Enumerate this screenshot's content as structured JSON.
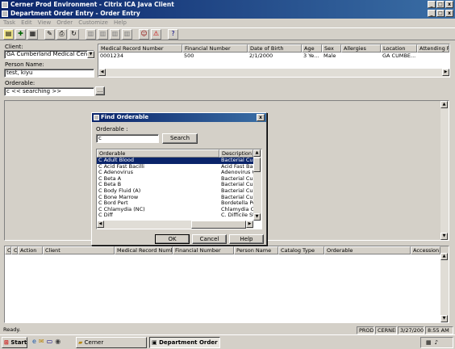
{
  "outer_window": {
    "title": "Cerner Prod Environment - Citrix ICA Java Client"
  },
  "app_window": {
    "title": "Department Order Entry - Order Entry"
  },
  "window_buttons": {
    "minimize": "_",
    "maximize": "□",
    "close": "x"
  },
  "menu": [
    "Task",
    "Edit",
    "View",
    "Order",
    "Customize",
    "Help"
  ],
  "toolbar_icons": [
    "open-icon",
    "new-order-icon",
    "multi-order-icon",
    "sign-icon",
    "print-icon",
    "refresh-icon",
    "grid1-icon",
    "grid2-icon",
    "grid3-icon",
    "grid4-icon",
    "person-icon",
    "alert-icon",
    "help-icon"
  ],
  "client": {
    "label": "Client:",
    "value": "GA Cumberland Medical Center"
  },
  "person": {
    "label": "Person Name:",
    "value": "test, kiyu"
  },
  "orderable": {
    "label": "Orderable:",
    "value": "c  << searching >>",
    "browse": "..."
  },
  "person_grid": {
    "columns": [
      "Medical Record Number",
      "Financial Number",
      "Date of Birth",
      "Age",
      "Sex",
      "Allergies",
      "Location",
      "Attending Phy"
    ],
    "row": [
      "0001234",
      "500",
      "2/1/2000",
      "3 Ye...",
      "Male",
      "",
      "GA CUMBE...",
      ""
    ]
  },
  "order_grid": {
    "columns": [
      "C",
      "C",
      "Action",
      "Client",
      "Medical Record Number",
      "Financial Number",
      "Person Name",
      "Catalog Type",
      "Orderable",
      "Accession"
    ]
  },
  "dialog": {
    "title": "Find Orderable",
    "close": "x",
    "orderable_label": "Orderable :",
    "search_value": "c",
    "search_button": "Search",
    "columns": [
      "Orderable",
      "Description"
    ],
    "rows": [
      [
        "C Adult Blood",
        "Bacterial Cultu"
      ],
      [
        "C Acid Fast Bacilli",
        "Acid Fast Bacil"
      ],
      [
        "C Adenovirus",
        "Adenovirus Cul"
      ],
      [
        "C Beta A",
        "Bacterial Cultu"
      ],
      [
        "C Beta B",
        "Bacterial Cultu"
      ],
      [
        "C Body Fluid (A)",
        "Bacterial Cultu"
      ],
      [
        "C Bone Marrow",
        "Bacterial Cultu"
      ],
      [
        "C Bord Pert",
        "Bordetella Pert"
      ],
      [
        "C Chlamydia (NC)",
        "Chlamydia Cultu"
      ],
      [
        "C Diff",
        "C. Difficile Stoo"
      ]
    ],
    "ok": "OK",
    "cancel": "Cancel",
    "help": "Help"
  },
  "status": {
    "left": "Ready.",
    "env": "PROD",
    "user": "CERNER",
    "date": "3/27/2003",
    "time": "8:55 AM"
  },
  "taskbar": {
    "start": "Start",
    "tasks": [
      "Cerner",
      "Department Order Ent..."
    ],
    "quick_launch": [
      "ie-icon",
      "outlook-icon",
      "desktop-icon",
      "media-icon"
    ],
    "tray_icons": [
      "network-icon",
      "volume-icon"
    ]
  }
}
